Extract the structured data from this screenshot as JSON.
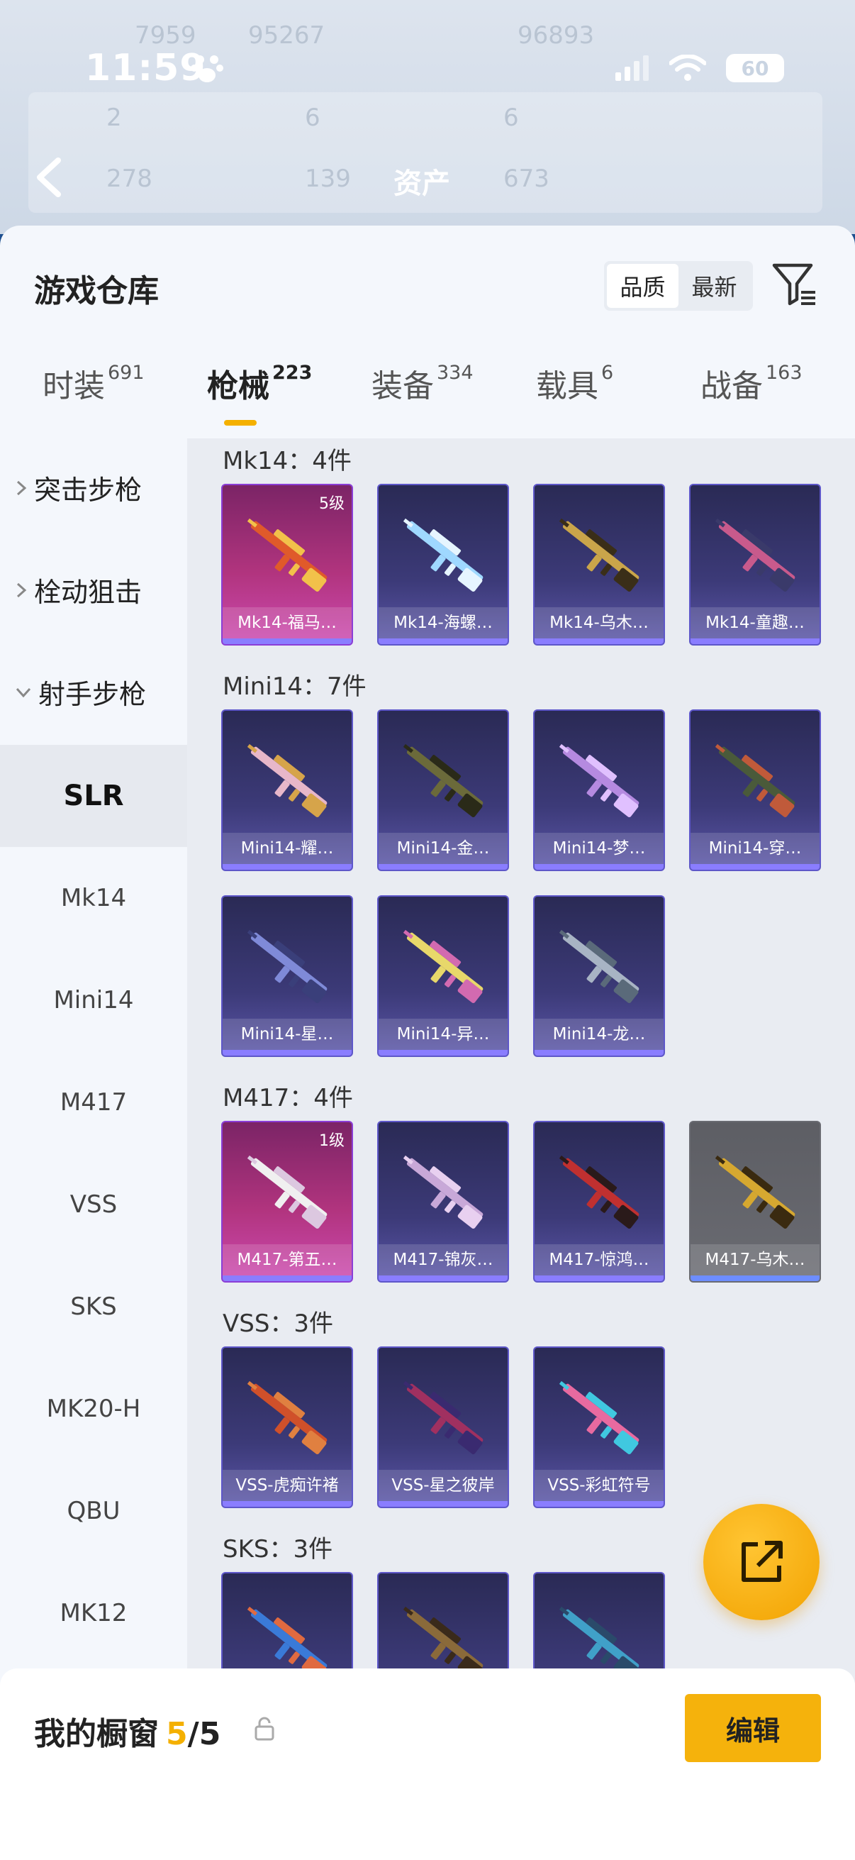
{
  "status_bar": {
    "time": "11:59",
    "battery": "60"
  },
  "background": {
    "title": "资产",
    "faint_numbers": [
      "7959",
      "95267",
      "96893",
      "2",
      "6",
      "6",
      "278",
      "139",
      "673"
    ]
  },
  "header": {
    "title": "游戏仓库",
    "sort_options": [
      {
        "label": "品质",
        "active": true
      },
      {
        "label": "最新",
        "active": false
      }
    ]
  },
  "tabs": [
    {
      "label": "时装",
      "count": "691"
    },
    {
      "label": "枪械",
      "count": "223",
      "active": true
    },
    {
      "label": "装备",
      "count": "334"
    },
    {
      "label": "载具",
      "count": "6"
    },
    {
      "label": "战备",
      "count": "163"
    }
  ],
  "sidebar": {
    "categories": [
      {
        "label": "突击步枪",
        "expanded": false
      },
      {
        "label": "栓动狙击",
        "expanded": false
      },
      {
        "label": "射手步枪",
        "expanded": true
      }
    ],
    "subcategories": [
      "SLR",
      "Mk14",
      "Mini14",
      "M417",
      "VSS",
      "SKS",
      "MK20-H",
      "QBU",
      "MK12"
    ],
    "active_subcategory": "SLR"
  },
  "groups": [
    {
      "label": "Mk14：4件",
      "items": [
        {
          "name": "Mk14-福马…",
          "level": "5级",
          "style": "pink"
        },
        {
          "name": "Mk14-海螺…"
        },
        {
          "name": "Mk14-乌木…"
        },
        {
          "name": "Mk14-童趣…"
        }
      ]
    },
    {
      "label": "Mini14：7件",
      "items": [
        {
          "name": "Mini14-耀…"
        },
        {
          "name": "Mini14-金…"
        },
        {
          "name": "Mini14-梦…"
        },
        {
          "name": "Mini14-穿…"
        },
        {
          "name": "Mini14-星…"
        },
        {
          "name": "Mini14-异…"
        },
        {
          "name": "Mini14-龙…"
        }
      ]
    },
    {
      "label": "M417：4件",
      "items": [
        {
          "name": "M417-第五…",
          "level": "1级",
          "style": "pink"
        },
        {
          "name": "M417-锦灰…"
        },
        {
          "name": "M417-惊鸿…"
        },
        {
          "name": "M417-乌木…",
          "style": "gray"
        }
      ]
    },
    {
      "label": "VSS：3件",
      "items": [
        {
          "name": "VSS-虎痴许褚"
        },
        {
          "name": "VSS-星之彼岸"
        },
        {
          "name": "VSS-彩虹符号"
        }
      ]
    },
    {
      "label": "SKS：3件",
      "items": [
        {
          "name": ""
        },
        {
          "name": ""
        },
        {
          "name": ""
        }
      ]
    }
  ],
  "bottom_bar": {
    "label": "我的橱窗",
    "used": "5",
    "separator": "/",
    "total": "5",
    "edit_label": "编辑"
  },
  "colors": {
    "accent": "#f4b000",
    "pink_card": "#b1347e",
    "purple_card": "#3c3a78",
    "gray_card": "#6a6b72"
  }
}
